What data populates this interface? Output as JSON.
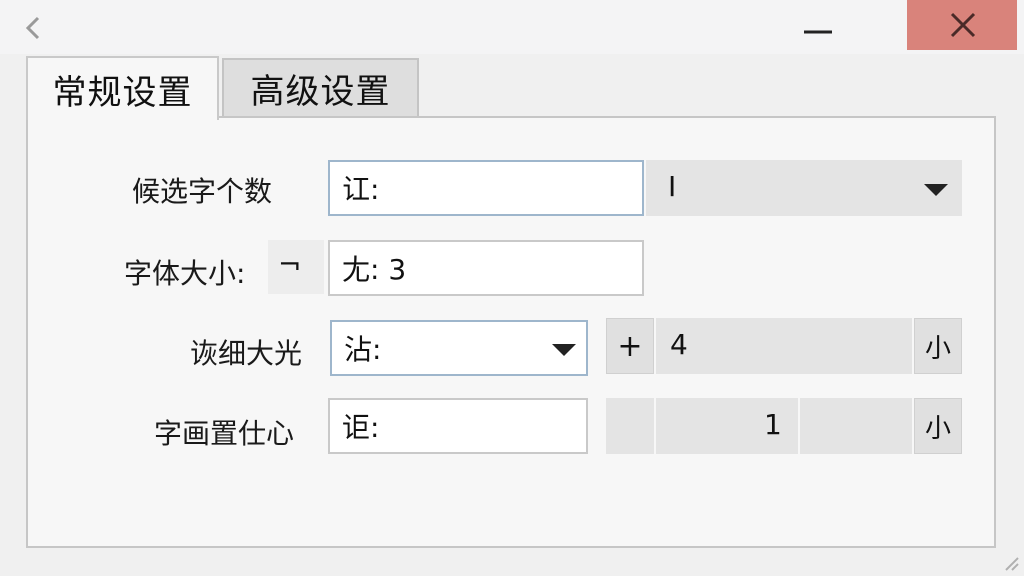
{
  "window": {
    "back_icon": "chevron-left-icon",
    "minimize_icon": "minimize-icon",
    "close_icon": "close-icon",
    "close_color": "#d9837b"
  },
  "tabs": [
    {
      "label": "常规设置",
      "active": true
    },
    {
      "label": "高级设置",
      "active": false
    }
  ],
  "rows": [
    {
      "label": "候选字个数",
      "field_value": "讧:",
      "extra_value": "I",
      "dropdown_icon": "dropdown-arrow-icon"
    },
    {
      "label": "字体大小:",
      "label_suffix": "¬",
      "field_value": "尢: 3"
    },
    {
      "label": "诙细大光",
      "field_value": "沾:",
      "dropdown_icon": "dropdown-arrow-icon",
      "stepper_plus": "+",
      "stepper_value": "4",
      "unit": "小"
    },
    {
      "label": "字画置仕心",
      "field_value": "讵:",
      "stepper_value": "1",
      "unit": "小"
    }
  ]
}
